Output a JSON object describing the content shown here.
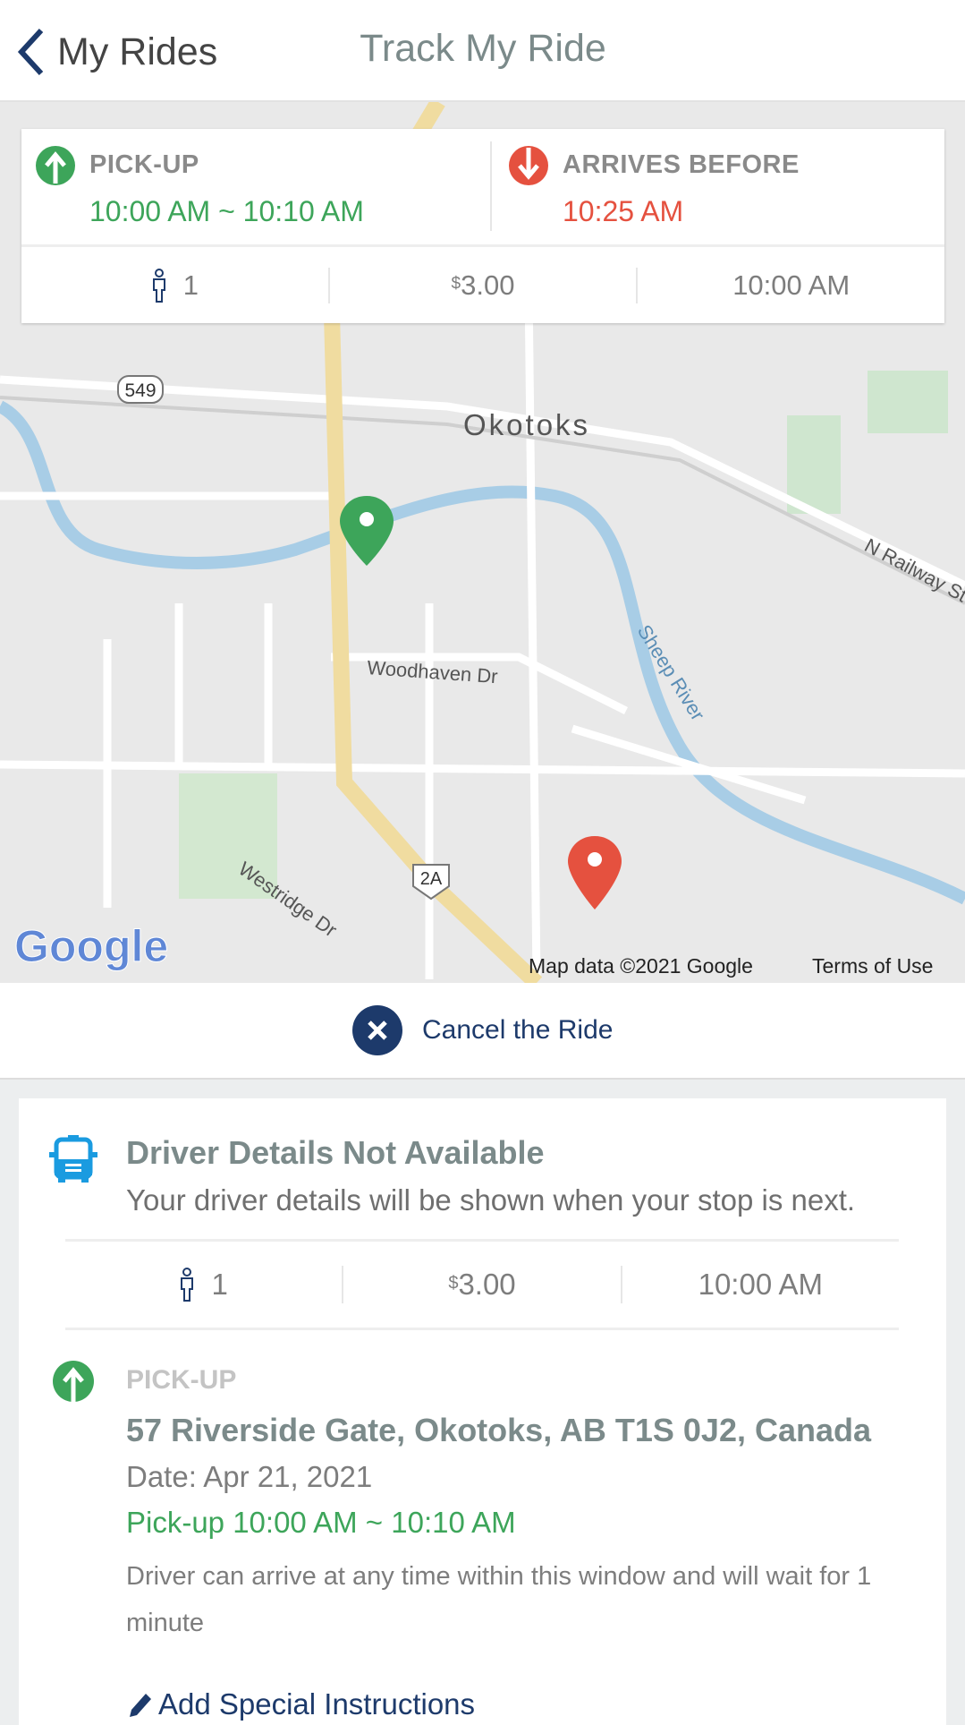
{
  "header": {
    "back_label": "My Rides",
    "title": "Track My Ride"
  },
  "summary": {
    "pickup_label": "PICK-UP",
    "pickup_window": "10:00 AM ~ 10:10 AM",
    "arrives_label": "ARRIVES BEFORE",
    "arrives_time": "10:25 AM",
    "passengers": "1",
    "fare_symbol": "$",
    "fare": "3.00",
    "time": "10:00 AM"
  },
  "map": {
    "labels": {
      "city": "Okotoks",
      "road1": "Woodhaven Dr",
      "road2": "Westridge Dr",
      "river": "Sheep River",
      "railway": "N Railway St",
      "hwy1": "549",
      "hwy2": "2A"
    },
    "google_logo": "Google",
    "attribution": "Map data ©2021 Google",
    "terms": "Terms of Use"
  },
  "cancel": {
    "label": "Cancel the Ride"
  },
  "driver": {
    "title": "Driver Details Not Available",
    "subtitle": "Your driver details will be shown when your stop is next.",
    "passengers": "1",
    "fare_symbol": "$",
    "fare": "3.00",
    "time": "10:00 AM"
  },
  "pickup": {
    "label": "PICK-UP",
    "address": "57 Riverside Gate, Okotoks, AB T1S 0J2, Canada",
    "date": "Date: Apr 21, 2021",
    "window": "Pick-up 10:00 AM ~ 10:10 AM",
    "note": "Driver can arrive at any time within this window and will wait for 1 minute",
    "add_instructions": "Add Special Instructions"
  },
  "colors": {
    "green": "#3da55a",
    "red": "#e5513f",
    "navy": "#1d3a6b",
    "bus": "#1a9be0"
  }
}
